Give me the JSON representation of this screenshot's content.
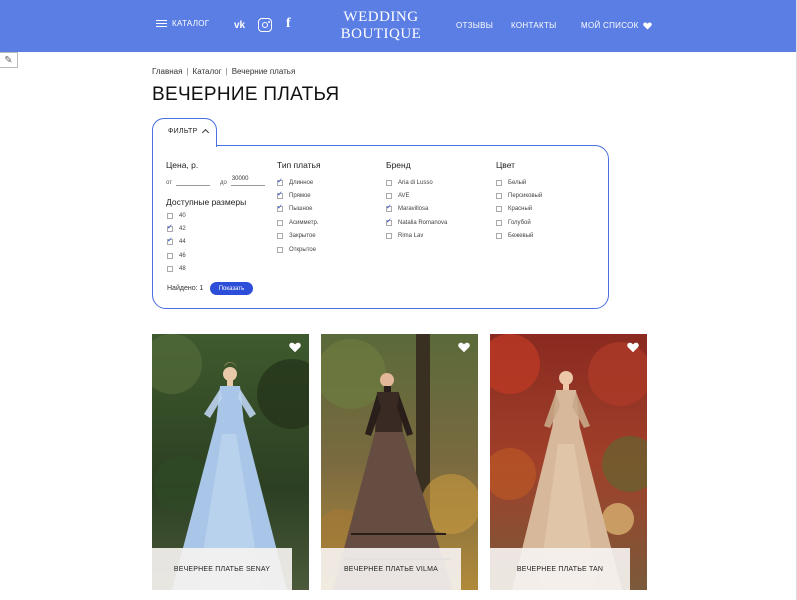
{
  "header": {
    "catalog_label": "КАТАЛОГ",
    "logo_line1": "WEDDING",
    "logo_line2": "BOUTIQUE",
    "reviews_label": "ОТЗЫВЫ",
    "contacts_label": "КОНТАКТЫ",
    "wishlist_label": "МОЙ СПИСОК",
    "social": {
      "vk": "vk",
      "facebook": "f"
    },
    "color": "#5b7ee5"
  },
  "breadcrumb": [
    "Главная",
    "Каталог",
    "Вечерние платья"
  ],
  "page_title": "ВЕЧЕРНИЕ ПЛАТЬЯ",
  "filter": {
    "tab_label": "ФИЛЬТР",
    "price": {
      "heading": "Цена, р.",
      "from_label": "от",
      "from_value": "",
      "to_label": "до",
      "to_value": "30000"
    },
    "sizes": {
      "heading": "Доступные размеры",
      "options": [
        {
          "label": "40",
          "checked": false
        },
        {
          "label": "42",
          "checked": true
        },
        {
          "label": "44",
          "checked": true
        },
        {
          "label": "46",
          "checked": false
        },
        {
          "label": "48",
          "checked": false
        }
      ]
    },
    "dress_type": {
      "heading": "Тип платья",
      "options": [
        {
          "label": "Длинное",
          "checked": true
        },
        {
          "label": "Прямое",
          "checked": true
        },
        {
          "label": "Пышное",
          "checked": true
        },
        {
          "label": "Асимметр.",
          "checked": false
        },
        {
          "label": "Закрытое",
          "checked": false
        },
        {
          "label": "Открытое",
          "checked": false
        }
      ]
    },
    "brand": {
      "heading": "Бренд",
      "options": [
        {
          "label": "Aria di Lusso",
          "checked": false
        },
        {
          "label": "AVE",
          "checked": false
        },
        {
          "label": "Maravillosa",
          "checked": true
        },
        {
          "label": "Natalia Romanova",
          "checked": true
        },
        {
          "label": "Rima Lav",
          "checked": false
        }
      ]
    },
    "color": {
      "heading": "Цвет",
      "options": [
        {
          "label": "Белый",
          "checked": false
        },
        {
          "label": "Персиковый",
          "checked": false
        },
        {
          "label": "Красный",
          "checked": false
        },
        {
          "label": "Голубой",
          "checked": false
        },
        {
          "label": "Бежевый",
          "checked": false
        }
      ]
    },
    "found_text": "Найдено: 1",
    "show_button": "Показать",
    "accent": "#2d4ed8"
  },
  "products": [
    {
      "name": "ВЕЧЕРНЕЕ ПЛАТЬЕ SENAY",
      "dress_color": "#a9c6e8"
    },
    {
      "name": "ВЕЧЕРНЕЕ ПЛАТЬЕ VILMA",
      "dress_color": "#3a2a24"
    },
    {
      "name": "ВЕЧЕРНЕЕ ПЛАТЬЕ TAN",
      "dress_color": "#d8b89a"
    }
  ]
}
